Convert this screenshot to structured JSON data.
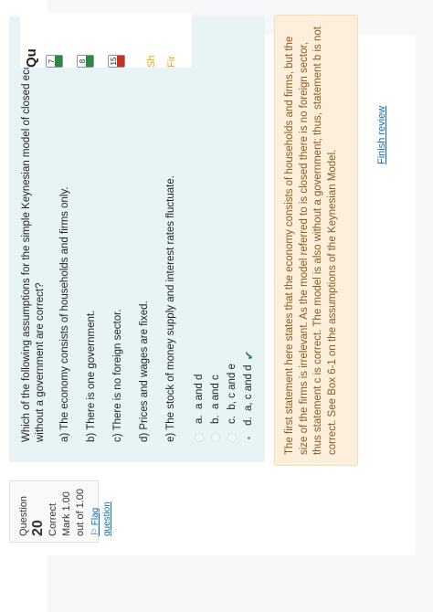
{
  "question": {
    "label": "Question",
    "number": "20",
    "status": "Correct",
    "mark": "Mark 1.00 out of 1.00",
    "flag_label": "Flag question",
    "text": "Which of the following assumptions for the simple Keynesian model of closed economy without a government are correct?",
    "options": [
      "a) The economy consists of households and firms only.",
      "b) There is one government.",
      "c) There is no foreign sector.",
      "d) Prices and wages are fixed.",
      "e) The stock of money supply and interest rates fluctuate."
    ],
    "answers": [
      {
        "letter": "a.",
        "text": "a and d"
      },
      {
        "letter": "b.",
        "text": "a and c"
      },
      {
        "letter": "c.",
        "text": "b, c and e"
      },
      {
        "letter": "d.",
        "text": "a, c and d"
      }
    ],
    "selected_index": 3,
    "correct_icon": "check-icon"
  },
  "feedback": "The first statement here states that the economy consists of households and firms, but the size of the firms is irrelevant. As the model referred to is closed there is no foreign sector, thus statement c is correct. The model is also without a government; thus, statement b is not correct. See Box 6-1 on the assumptions of the Keynesian Model.",
  "finish_review": "Finish review",
  "nav": {
    "title": "Qu",
    "buttons": [
      {
        "label": "7",
        "state": "correct"
      },
      {
        "label": "8",
        "state": "correct"
      },
      {
        "label": "15",
        "state": "incorrect"
      }
    ],
    "show_label": "Sh",
    "finish_label": "Fir"
  },
  "colors": {
    "correct": "#2b8a3e",
    "incorrect": "#ca3120",
    "link": "#0f6cbf",
    "feedback_bg": "#fcefdc",
    "question_bg": "#e7f3f5"
  }
}
